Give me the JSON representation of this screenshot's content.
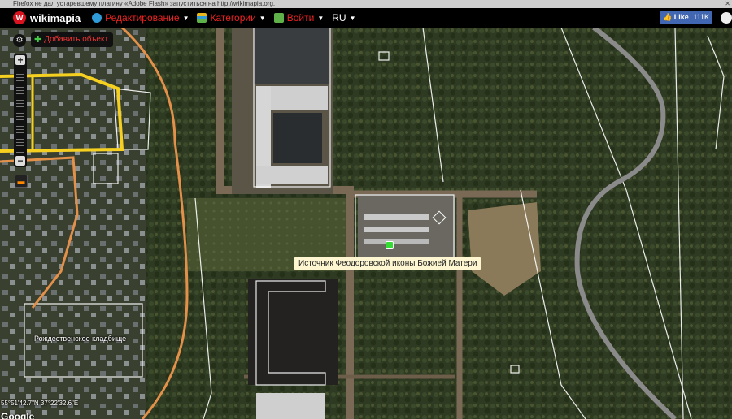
{
  "notification": {
    "text": "Firefox не дал устаревшему плагину «Adobe Flash» запуститься на http://wikimapia.org."
  },
  "header": {
    "logo_text": "wikimapia",
    "menus": [
      {
        "label": "Редактирование",
        "icon": "globe-edit-icon",
        "color": "#2f9cd8"
      },
      {
        "label": "Категории",
        "icon": "categories-icon",
        "color": "#e8b81e"
      },
      {
        "label": "Войти",
        "icon": "login-icon",
        "color": "#5fb24a"
      }
    ],
    "language": "RU",
    "fb_like_label": "Like",
    "fb_like_count": "111K"
  },
  "map": {
    "add_object_label": "Добавить объект",
    "poi_label": "Источник Феодоровской иконы Божией Матери",
    "cemetery_label": "Рождественское кладбище",
    "coordinates": "55°51'42.7\"N 37°22'32.6\"E",
    "provider": "Google",
    "colors": {
      "brand_red": "#d8121f",
      "road_yellow": "#f5d020",
      "road_orange": "#e2904a"
    }
  }
}
